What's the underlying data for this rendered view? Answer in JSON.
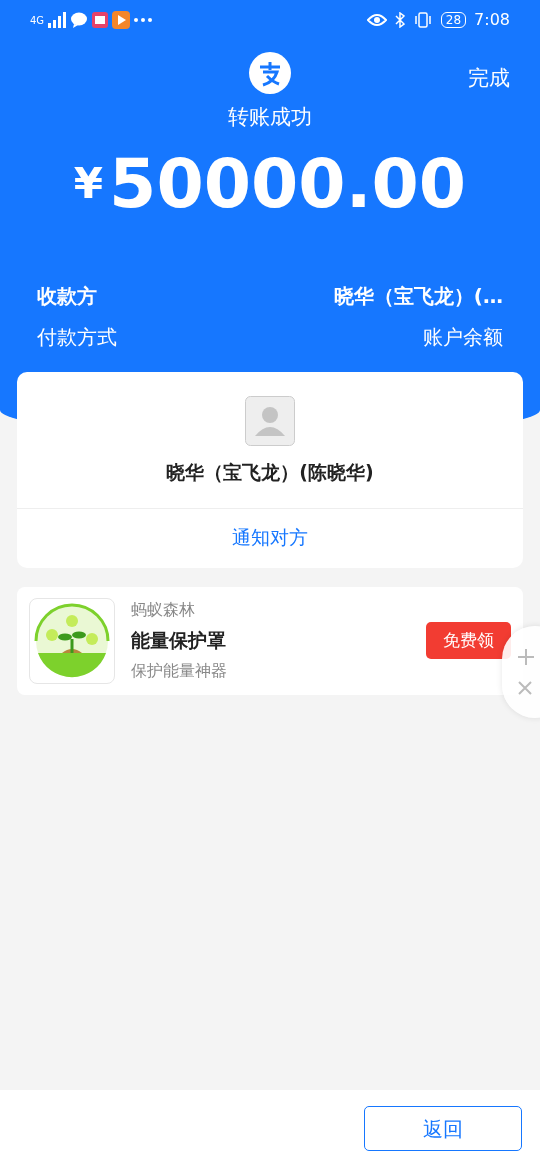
{
  "status_bar": {
    "network": "4G",
    "battery": "28",
    "time": "7:08"
  },
  "header": {
    "done_label": "完成",
    "title": "转账成功",
    "currency": "¥",
    "amount": "50000.00"
  },
  "summary": [
    {
      "label": "收款方",
      "value": "晓华（宝飞龙）(…",
      "bold": true
    },
    {
      "label": "付款方式",
      "value": "账户余额",
      "bold": false
    }
  ],
  "payee": {
    "name": "晓华（宝飞龙）(陈晓华)",
    "action": "通知对方"
  },
  "promo": {
    "brand": "蚂蚁森林",
    "title": "能量保护罩",
    "subtitle": "保护能量神器",
    "button": "免费领"
  },
  "footer": {
    "button": "返回"
  }
}
